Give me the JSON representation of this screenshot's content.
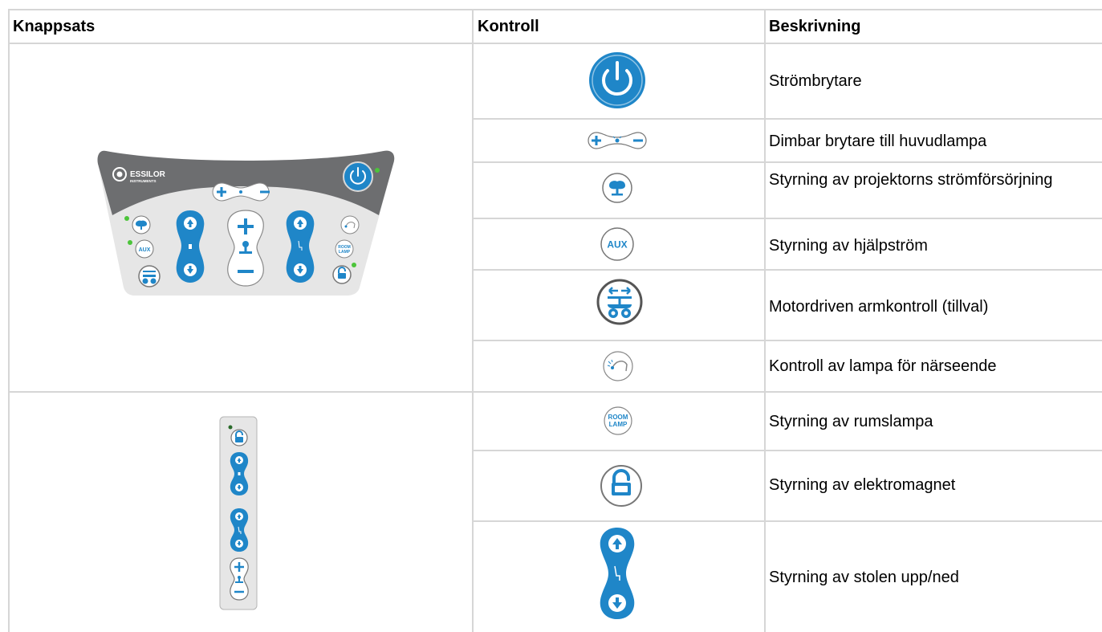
{
  "headers": {
    "keypad": "Knappsats",
    "control": "Kontroll",
    "description": "Beskrivning"
  },
  "rows": [
    {
      "icon": "power-icon",
      "description": "Strömbrytare"
    },
    {
      "icon": "dimmer-icon",
      "description": "Dimbar brytare till huvudlampa"
    },
    {
      "icon": "projector-icon",
      "description": "Styrning av projektorns strömförsörjning"
    },
    {
      "icon": "aux-icon",
      "description": "Styrning av hjälpström"
    },
    {
      "icon": "motorized-arm-icon",
      "description": "Motordriven armkontroll (tillval)"
    },
    {
      "icon": "near-lamp-icon",
      "description": "Kontroll av lampa för närseende"
    },
    {
      "icon": "room-lamp-icon",
      "description": "Styrning av rumslampa"
    },
    {
      "icon": "electromagnet-icon",
      "description": "Styrning av elektromagnet"
    },
    {
      "icon": "chair-updown-icon",
      "description": "Styrning av stolen upp/ned"
    }
  ],
  "keypad_panel": {
    "brand": "ESSILOR",
    "brand_sub": "INSTRUMENTS",
    "aux_label": "AUX",
    "room_label_1": "ROOM",
    "room_label_2": "LAMP"
  },
  "colors": {
    "blue": "#1f86c8",
    "panel_dark": "#6d6e70",
    "panel_light": "#e6e6e6",
    "led_green": "#4cc43a",
    "grid": "#d6d6d6"
  }
}
